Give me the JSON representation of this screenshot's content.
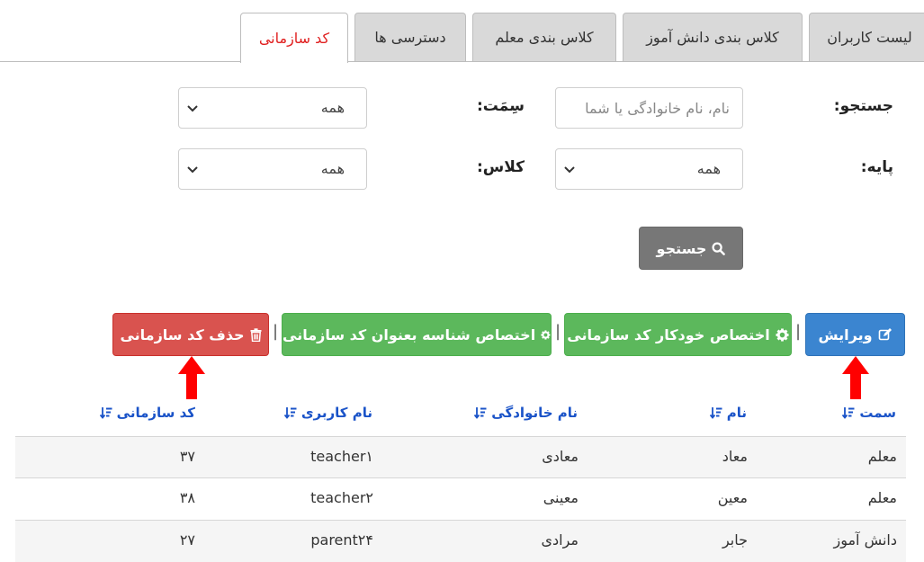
{
  "tabs": [
    {
      "label": "لیست کاربران",
      "active": false
    },
    {
      "label": "کلاس بندی دانش آموز",
      "active": false
    },
    {
      "label": "کلاس بندی معلم",
      "active": false
    },
    {
      "label": "دسترسی ها",
      "active": false
    },
    {
      "label": "کد سازمانی",
      "active": true
    }
  ],
  "filters": {
    "search_label": "جستجو:",
    "search_placeholder": "نام، نام خانوادگی یا شما",
    "role_label": "سِمَت:",
    "role_value": "همه",
    "grade_label": "پایه:",
    "grade_value": "همه",
    "class_label": "کلاس:",
    "class_value": "همه",
    "search_button": "جستجو"
  },
  "actions": {
    "edit": "ویرایش",
    "auto_assign": "اختصاص خودکار کد سازمانی",
    "assign_id": "اختصاص شناسه بعنوان کد سازمانی",
    "delete": "حذف کد سازمانی",
    "separator": "|"
  },
  "table": {
    "columns": [
      "سمت",
      "نام",
      "نام خانوادگی",
      "نام کاربری",
      "کد سازمانی"
    ],
    "rows": [
      [
        "معلم",
        "معاد",
        "معادی",
        "teacher۱",
        "۳۷"
      ],
      [
        "معلم",
        "معین",
        "معینی",
        "teacher۲",
        "۳۸"
      ],
      [
        "دانش آموز",
        "جابر",
        "مرادی",
        "parent۲۴",
        "۲۷"
      ]
    ]
  },
  "colors": {
    "active_tab_text": "#e02020",
    "header_link": "#1a53c8",
    "edit_button": "#3b85d0",
    "assign_button": "#5cb85c",
    "delete_button": "#d9534f",
    "search_button": "#777777",
    "annotation_arrow": "#ff0000"
  }
}
